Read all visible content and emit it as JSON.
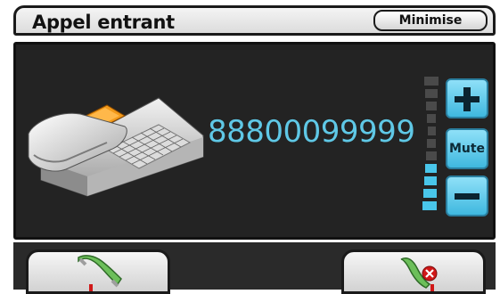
{
  "header": {
    "title": "Appel entrant",
    "minimise_label": "Minimise"
  },
  "call": {
    "number": "88800099999"
  },
  "volume": {
    "mute_label": "Mute",
    "level_fraction": 0.44
  },
  "colors": {
    "accent": "#49c6ea",
    "panel": "#232323",
    "reject_red": "#d01818",
    "answer_green": "#6cbf5a"
  },
  "icons": {
    "answer": "answer-phone-icon",
    "reject": "reject-phone-icon",
    "phone": "desk-phone-icon",
    "plus": "plus-icon",
    "minus": "minus-icon"
  }
}
